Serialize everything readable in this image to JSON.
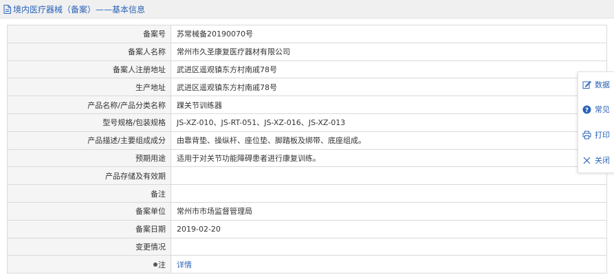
{
  "header": {
    "title": "境内医疗器械（备案）——基本信息",
    "icon": "document-icon"
  },
  "rows": [
    {
      "label": "备案号",
      "value": "苏常械备20190070号"
    },
    {
      "label": "备案人名称",
      "value": "常州市久圣康复医疗器材有限公司"
    },
    {
      "label": "备案人注册地址",
      "value": "武进区遥观镇东方村南戚78号"
    },
    {
      "label": "生产地址",
      "value": "武进区遥观镇东方村南戚78号"
    },
    {
      "label": "产品名称/产品分类名称",
      "value": "踝关节训练器"
    },
    {
      "label": "型号规格/包装规格",
      "value": "JS-XZ-010、JS-RT-051、JS-XZ-016、JS-XZ-013"
    },
    {
      "label": "产品描述/主要组成成分",
      "value": "由靠背垫、操纵杆、座位垫、脚踏板及绑带、底座组成。"
    },
    {
      "label": "预期用途",
      "value": "适用于对关节功能障碍患者进行康复训练。"
    },
    {
      "label": "产品存储及有效期",
      "value": ""
    },
    {
      "label": "备注",
      "value": ""
    },
    {
      "label": "备案单位",
      "value": "常州市市场监督管理局"
    },
    {
      "label": "备案日期",
      "value": "2019-02-20"
    },
    {
      "label": "变更情况",
      "value": ""
    },
    {
      "label": "注",
      "value": "详情"
    }
  ],
  "float_menu": [
    {
      "label": "数据",
      "icon": "edit-icon"
    },
    {
      "label": "常见",
      "icon": "help-icon"
    },
    {
      "label": "打印",
      "icon": "printer-icon"
    },
    {
      "label": "关闭",
      "icon": "close-icon"
    }
  ],
  "colors": {
    "accent": "#2a63b8",
    "label_bg": "#f5f5f5",
    "border": "#d9d9d9",
    "header_bg": "#f0f0f0"
  }
}
